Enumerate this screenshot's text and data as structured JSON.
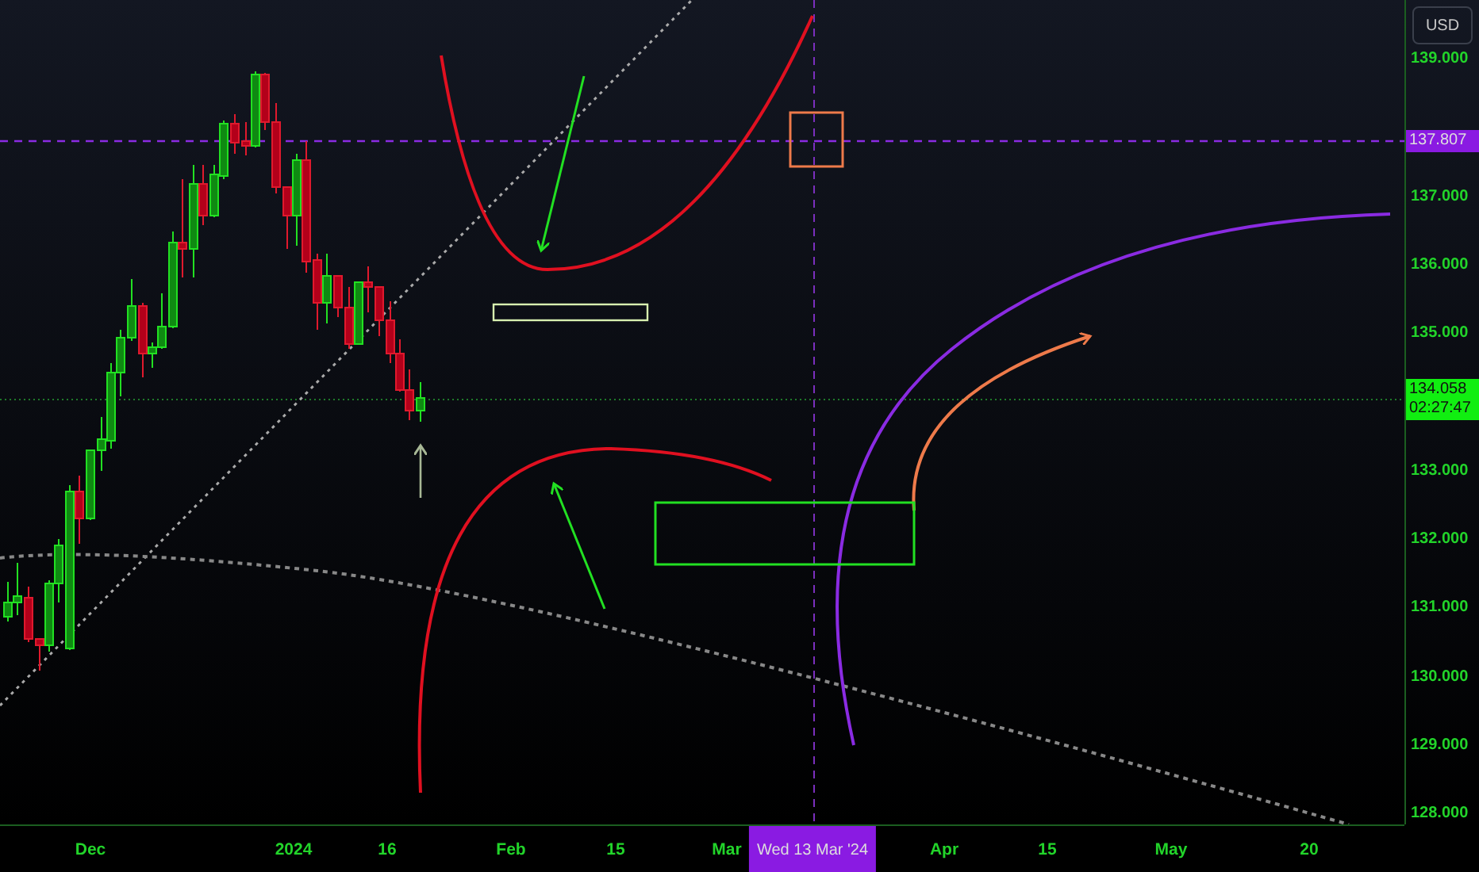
{
  "price_axis": {
    "currency": "USD",
    "ticks": [
      "139.000",
      "137.000",
      "136.000",
      "135.000",
      "133.000",
      "132.000",
      "131.000",
      "130.000",
      "129.000",
      "128.000"
    ],
    "crosshair_label": "137.807",
    "last_price": {
      "price": "134.058",
      "countdown": "02:27:47"
    }
  },
  "time_axis": {
    "labels": [
      "Dec",
      "2024",
      "16",
      "Feb",
      "15",
      "Mar",
      "Apr",
      "15",
      "May",
      "20"
    ],
    "crosshair_label": "Wed 13 Mar '24"
  }
}
